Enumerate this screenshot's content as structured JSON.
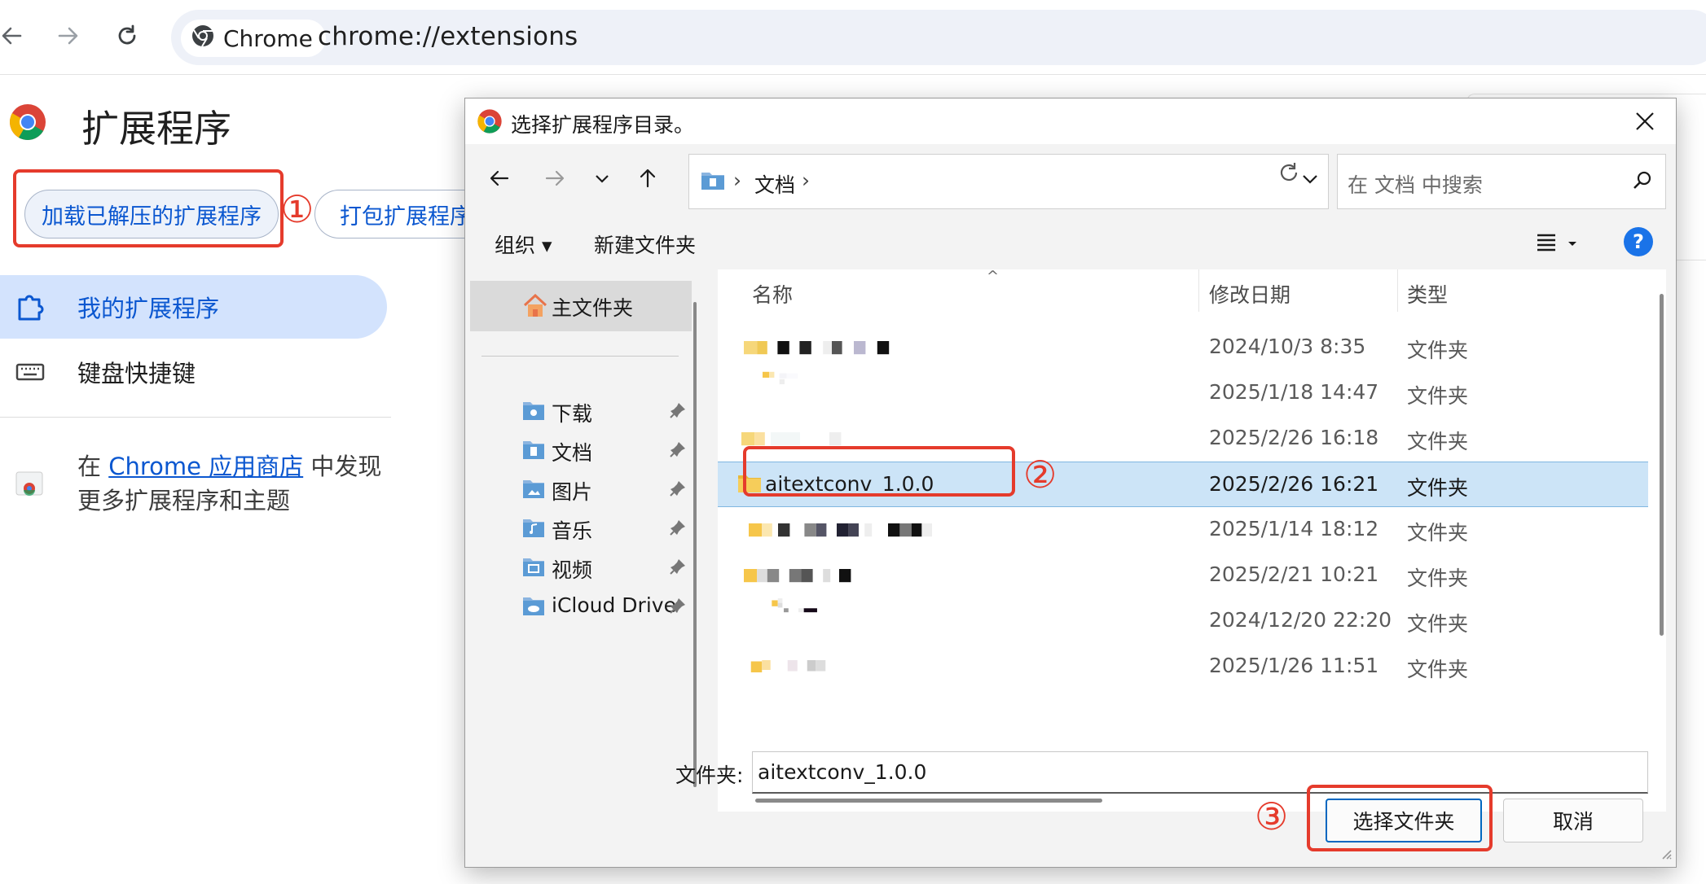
{
  "browser": {
    "chip_label": "Chrome",
    "url": "chrome://extensions"
  },
  "extensions_page": {
    "title": "扩展程序",
    "load_unpacked": "加载已解压的扩展程序",
    "pack_extension": "打包扩展程序",
    "nav": [
      {
        "label": "我的扩展程序",
        "active": true
      },
      {
        "label": "键盘快捷键",
        "active": false
      }
    ],
    "store_prefix": "在 ",
    "store_link": "Chrome 应用商店",
    "store_suffix": " 中发现更多扩展程序和主题"
  },
  "annotations": {
    "step1": "①",
    "step2": "②",
    "step3": "③",
    "color": "#e53b2c"
  },
  "dialog": {
    "title": "选择扩展程序目录。",
    "breadcrumb": "文档",
    "search_placeholder": "在 文档 中搜索",
    "organize": "组织",
    "new_folder": "新建文件夹",
    "nav_pane": {
      "home": "主文件夹",
      "items": [
        "下载",
        "文档",
        "图片",
        "音乐",
        "视频",
        "iCloud Drive"
      ]
    },
    "columns": {
      "name": "名称",
      "date": "修改日期",
      "type": "类型"
    },
    "rows": [
      {
        "name": "",
        "date": "2024/10/3 8:35",
        "type": "文件夹",
        "selected": false
      },
      {
        "name": "",
        "date": "2025/1/18 14:47",
        "type": "文件夹",
        "selected": false
      },
      {
        "name": "",
        "date": "2025/2/26 16:18",
        "type": "文件夹",
        "selected": false
      },
      {
        "name": "aitextconv_1.0.0",
        "date": "2025/2/26 16:21",
        "type": "文件夹",
        "selected": true
      },
      {
        "name": "",
        "date": "2025/1/14 18:12",
        "type": "文件夹",
        "selected": false
      },
      {
        "name": "",
        "date": "2025/2/21 10:21",
        "type": "文件夹",
        "selected": false
      },
      {
        "name": "",
        "date": "2024/12/20 22:20",
        "type": "文件夹",
        "selected": false
      },
      {
        "name": "",
        "date": "2025/1/26 11:51",
        "type": "文件夹",
        "selected": false
      }
    ],
    "folder_label": "文件夹:",
    "folder_value": "aitextconv_1.0.0",
    "select_button": "选择文件夹",
    "cancel_button": "取消"
  }
}
